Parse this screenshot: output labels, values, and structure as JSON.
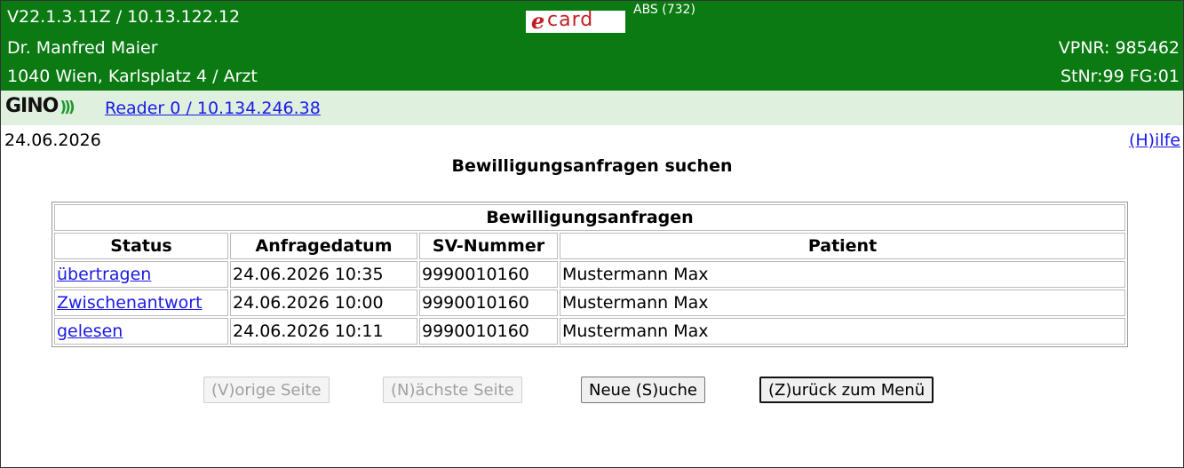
{
  "header": {
    "version": "V22.1.3.11Z / 10.13.122.12",
    "logo_e": "e",
    "logo_card": "card",
    "abs": "ABS (732)",
    "doctor": "Dr. Manfred Maier",
    "vpnr": "VPNR: 985462",
    "address": "1040 Wien, Karlsplatz 4 / Arzt",
    "stnr": "StNr:99 FG:01"
  },
  "gino": {
    "logo": "GINO",
    "reader_link": "Reader 0 / 10.134.246.38"
  },
  "date": "24.06.2026",
  "help_link": "(H)ilfe",
  "page_title": "Bewilligungsanfragen suchen",
  "table": {
    "caption": "Bewilligungsanfragen",
    "headers": [
      "Status",
      "Anfragedatum",
      "SV-Nummer",
      "Patient"
    ],
    "rows": [
      {
        "status": "übertragen",
        "date": "24.06.2026 10:35",
        "sv": "9990010160",
        "patient": "Mustermann Max"
      },
      {
        "status": "Zwischenantwort",
        "date": "24.06.2026 10:00",
        "sv": "9990010160",
        "patient": "Mustermann Max"
      },
      {
        "status": "gelesen",
        "date": "24.06.2026 10:11",
        "sv": "9990010160",
        "patient": "Mustermann Max"
      }
    ]
  },
  "buttons": {
    "prev": "(V)orige Seite",
    "next": "(N)ächste Seite",
    "new_search": "Neue (S)uche",
    "back": "(Z)urück zum Menü"
  }
}
